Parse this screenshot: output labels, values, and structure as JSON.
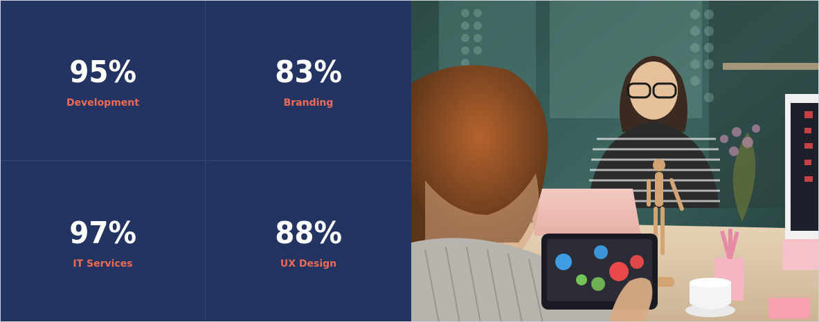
{
  "stats": [
    {
      "value": "95%",
      "label": "Development"
    },
    {
      "value": "83%",
      "label": "Branding"
    },
    {
      "value": "97%",
      "label": "IT Services"
    },
    {
      "value": "88%",
      "label": "UX Design"
    }
  ],
  "colors": {
    "panel_bg": "#233462",
    "value_text": "#ffffff",
    "label_text": "#f06a54"
  },
  "photo": {
    "description_icon": "office-photo"
  }
}
